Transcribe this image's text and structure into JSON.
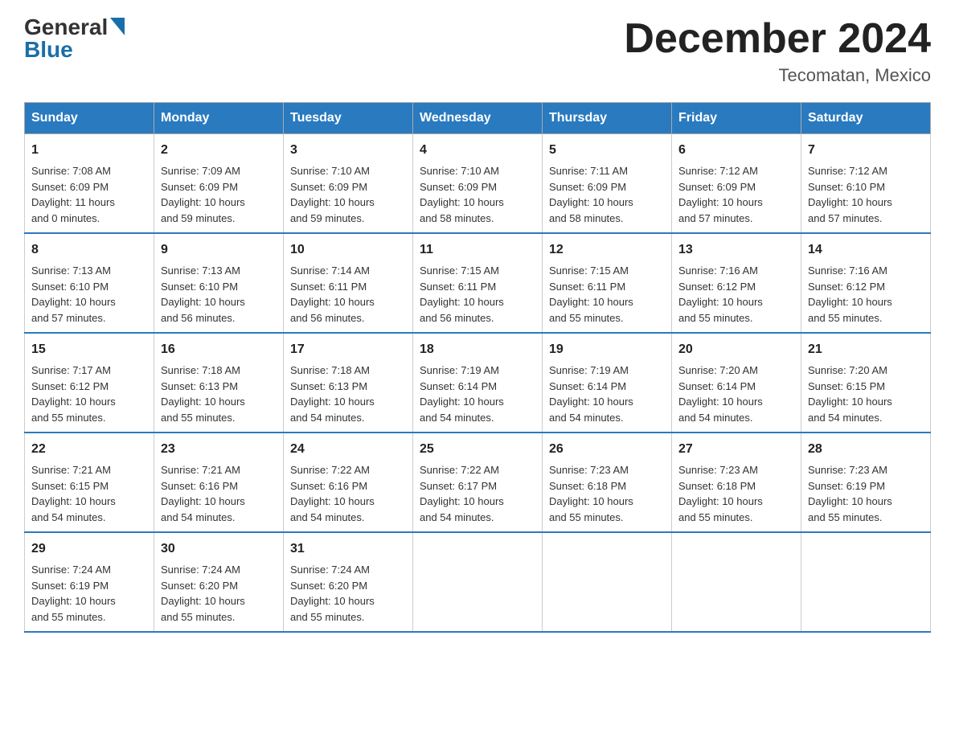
{
  "header": {
    "logo_general": "General",
    "logo_blue": "Blue",
    "month_title": "December 2024",
    "location": "Tecomatan, Mexico"
  },
  "days_of_week": [
    "Sunday",
    "Monday",
    "Tuesday",
    "Wednesday",
    "Thursday",
    "Friday",
    "Saturday"
  ],
  "weeks": [
    [
      {
        "day": "1",
        "sunrise": "7:08 AM",
        "sunset": "6:09 PM",
        "daylight": "11 hours and 0 minutes."
      },
      {
        "day": "2",
        "sunrise": "7:09 AM",
        "sunset": "6:09 PM",
        "daylight": "10 hours and 59 minutes."
      },
      {
        "day": "3",
        "sunrise": "7:10 AM",
        "sunset": "6:09 PM",
        "daylight": "10 hours and 59 minutes."
      },
      {
        "day": "4",
        "sunrise": "7:10 AM",
        "sunset": "6:09 PM",
        "daylight": "10 hours and 58 minutes."
      },
      {
        "day": "5",
        "sunrise": "7:11 AM",
        "sunset": "6:09 PM",
        "daylight": "10 hours and 58 minutes."
      },
      {
        "day": "6",
        "sunrise": "7:12 AM",
        "sunset": "6:09 PM",
        "daylight": "10 hours and 57 minutes."
      },
      {
        "day": "7",
        "sunrise": "7:12 AM",
        "sunset": "6:10 PM",
        "daylight": "10 hours and 57 minutes."
      }
    ],
    [
      {
        "day": "8",
        "sunrise": "7:13 AM",
        "sunset": "6:10 PM",
        "daylight": "10 hours and 57 minutes."
      },
      {
        "day": "9",
        "sunrise": "7:13 AM",
        "sunset": "6:10 PM",
        "daylight": "10 hours and 56 minutes."
      },
      {
        "day": "10",
        "sunrise": "7:14 AM",
        "sunset": "6:11 PM",
        "daylight": "10 hours and 56 minutes."
      },
      {
        "day": "11",
        "sunrise": "7:15 AM",
        "sunset": "6:11 PM",
        "daylight": "10 hours and 56 minutes."
      },
      {
        "day": "12",
        "sunrise": "7:15 AM",
        "sunset": "6:11 PM",
        "daylight": "10 hours and 55 minutes."
      },
      {
        "day": "13",
        "sunrise": "7:16 AM",
        "sunset": "6:12 PM",
        "daylight": "10 hours and 55 minutes."
      },
      {
        "day": "14",
        "sunrise": "7:16 AM",
        "sunset": "6:12 PM",
        "daylight": "10 hours and 55 minutes."
      }
    ],
    [
      {
        "day": "15",
        "sunrise": "7:17 AM",
        "sunset": "6:12 PM",
        "daylight": "10 hours and 55 minutes."
      },
      {
        "day": "16",
        "sunrise": "7:18 AM",
        "sunset": "6:13 PM",
        "daylight": "10 hours and 55 minutes."
      },
      {
        "day": "17",
        "sunrise": "7:18 AM",
        "sunset": "6:13 PM",
        "daylight": "10 hours and 54 minutes."
      },
      {
        "day": "18",
        "sunrise": "7:19 AM",
        "sunset": "6:14 PM",
        "daylight": "10 hours and 54 minutes."
      },
      {
        "day": "19",
        "sunrise": "7:19 AM",
        "sunset": "6:14 PM",
        "daylight": "10 hours and 54 minutes."
      },
      {
        "day": "20",
        "sunrise": "7:20 AM",
        "sunset": "6:14 PM",
        "daylight": "10 hours and 54 minutes."
      },
      {
        "day": "21",
        "sunrise": "7:20 AM",
        "sunset": "6:15 PM",
        "daylight": "10 hours and 54 minutes."
      }
    ],
    [
      {
        "day": "22",
        "sunrise": "7:21 AM",
        "sunset": "6:15 PM",
        "daylight": "10 hours and 54 minutes."
      },
      {
        "day": "23",
        "sunrise": "7:21 AM",
        "sunset": "6:16 PM",
        "daylight": "10 hours and 54 minutes."
      },
      {
        "day": "24",
        "sunrise": "7:22 AM",
        "sunset": "6:16 PM",
        "daylight": "10 hours and 54 minutes."
      },
      {
        "day": "25",
        "sunrise": "7:22 AM",
        "sunset": "6:17 PM",
        "daylight": "10 hours and 54 minutes."
      },
      {
        "day": "26",
        "sunrise": "7:23 AM",
        "sunset": "6:18 PM",
        "daylight": "10 hours and 55 minutes."
      },
      {
        "day": "27",
        "sunrise": "7:23 AM",
        "sunset": "6:18 PM",
        "daylight": "10 hours and 55 minutes."
      },
      {
        "day": "28",
        "sunrise": "7:23 AM",
        "sunset": "6:19 PM",
        "daylight": "10 hours and 55 minutes."
      }
    ],
    [
      {
        "day": "29",
        "sunrise": "7:24 AM",
        "sunset": "6:19 PM",
        "daylight": "10 hours and 55 minutes."
      },
      {
        "day": "30",
        "sunrise": "7:24 AM",
        "sunset": "6:20 PM",
        "daylight": "10 hours and 55 minutes."
      },
      {
        "day": "31",
        "sunrise": "7:24 AM",
        "sunset": "6:20 PM",
        "daylight": "10 hours and 55 minutes."
      },
      null,
      null,
      null,
      null
    ]
  ]
}
